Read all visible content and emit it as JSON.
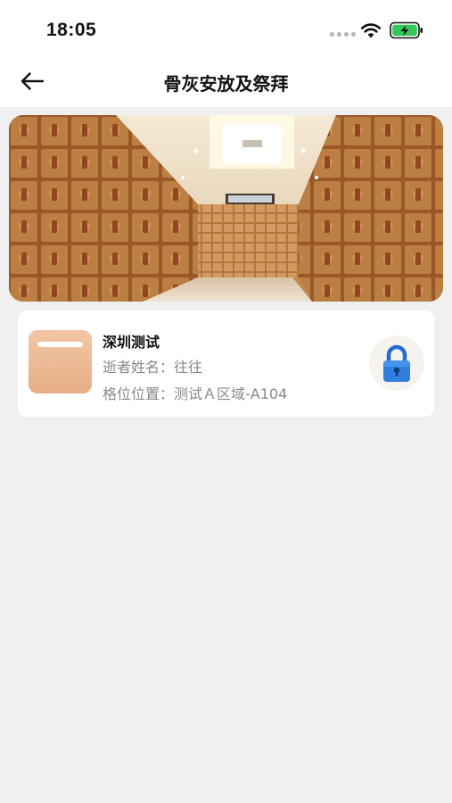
{
  "status_bar": {
    "time": "18:05",
    "icons": [
      "signal-dots-icon",
      "wifi-icon",
      "battery-charging-icon"
    ],
    "battery_color": "#34c759"
  },
  "nav": {
    "back_icon": "arrow-left-icon",
    "title": "骨灰安放及祭拜"
  },
  "banner": {
    "image": "columbarium-hall-photo"
  },
  "record": {
    "title": "深圳测试",
    "deceased_label": "逝者姓名：",
    "deceased_value": "往往",
    "location_label": "格位位置：",
    "location_value": "测试Ａ区域-A104",
    "thumb_color": "#edb993",
    "lock_icon": "padlock-icon",
    "lock_color": "#2e7fe0"
  }
}
